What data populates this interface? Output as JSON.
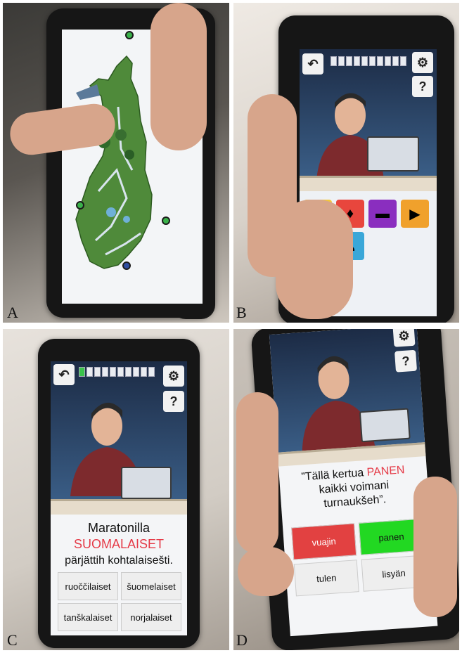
{
  "panels": [
    {
      "id": "A",
      "letter": "A",
      "content": "map"
    },
    {
      "id": "B",
      "letter": "B",
      "content": "word-categories"
    },
    {
      "id": "C",
      "letter": "C",
      "content": "quiz"
    },
    {
      "id": "D",
      "letter": "D",
      "content": "quiz-answered"
    }
  ],
  "panel_c": {
    "sentence_before": "Maratonilla",
    "highlight": "SUOMALAISET",
    "sentence_after": "pärjättih kohtalaisešti.",
    "answers": [
      "ruoččilaiset",
      "šuomelaiset",
      "tanškalaiset",
      "norjalaiset"
    ],
    "progress_filled": 1,
    "progress_total": 10
  },
  "panel_d": {
    "line1_before": "”Tällä kertua ",
    "highlight": "PANEN",
    "line2": "kaikki voimani",
    "line3": "turnaukšeh”.",
    "answers": [
      {
        "label": "vuajin",
        "state": "wrong"
      },
      {
        "label": "panen",
        "state": "right"
      },
      {
        "label": "tulen",
        "state": "neutral"
      },
      {
        "label": "lisyän",
        "state": "neutral"
      }
    ]
  },
  "icons": {
    "back": "back-arrow-icon",
    "settings": "settings-gears-icon",
    "help": "help-question-icon"
  },
  "colors": {
    "highlight": "#e53a47",
    "correct": "#22d822",
    "wrong": "#e24141",
    "progress_on": "#39c24a"
  }
}
